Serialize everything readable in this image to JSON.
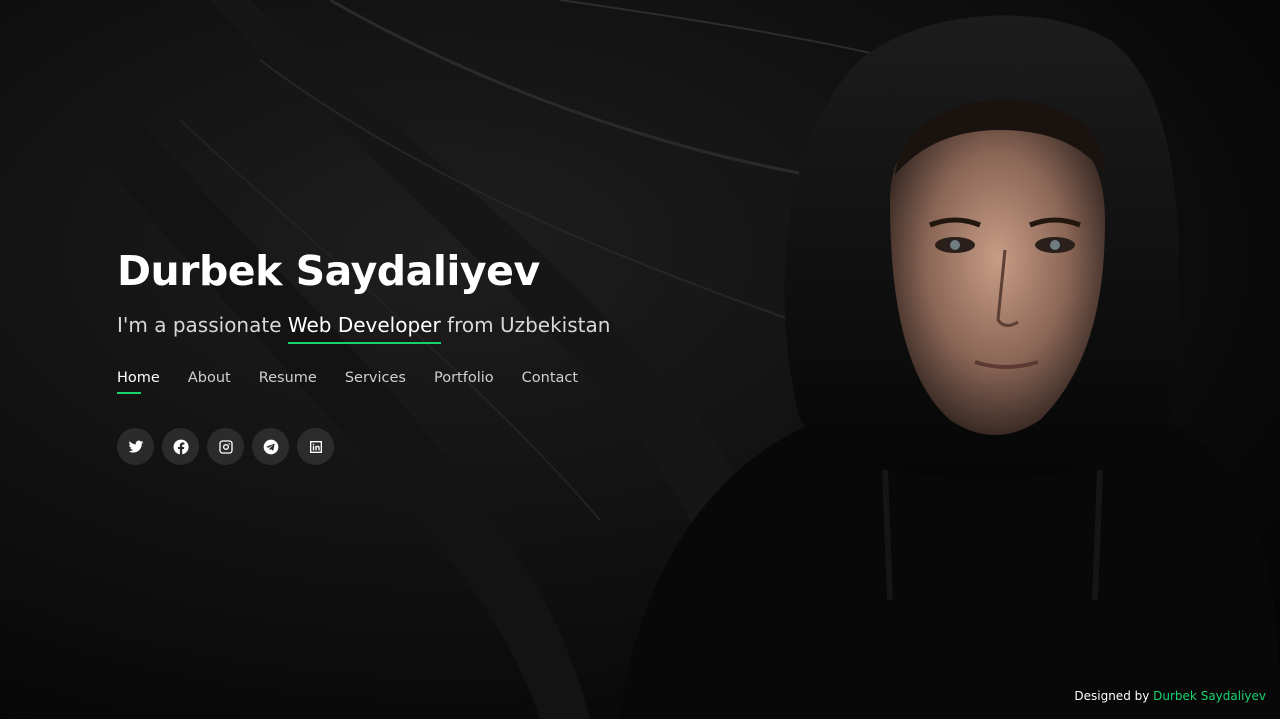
{
  "hero": {
    "name": "Durbek Saydaliyev",
    "tagline_prefix": "I'm a passionate ",
    "tagline_role": "Web Developer",
    "tagline_suffix": " from Uzbekistan"
  },
  "nav": {
    "items": [
      {
        "label": "Home",
        "active": true
      },
      {
        "label": "About",
        "active": false
      },
      {
        "label": "Resume",
        "active": false
      },
      {
        "label": "Services",
        "active": false
      },
      {
        "label": "Portfolio",
        "active": false
      },
      {
        "label": "Contact",
        "active": false
      }
    ]
  },
  "social": {
    "icons": [
      "twitter-icon",
      "facebook-icon",
      "instagram-icon",
      "telegram-icon",
      "linkedin-icon"
    ]
  },
  "footer": {
    "designed_by": "Designed by ",
    "author": "Durbek Saydaliyev"
  },
  "colors": {
    "accent": "#18d26e",
    "background": "#0d0d0d"
  }
}
